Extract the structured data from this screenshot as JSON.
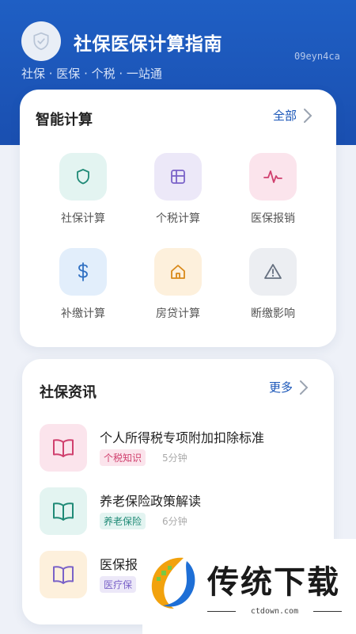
{
  "header": {
    "title": "社保医保计算指南",
    "subtitle": "社保 · 医保 · 个税 · 一站通",
    "tag": "09eyn4ca",
    "logo_icon": "shield-check-icon"
  },
  "calc": {
    "title": "智能计算",
    "all_label": "全部",
    "items": [
      {
        "label": "社保计算",
        "icon": "shield-icon",
        "bg": "#e3f4f1",
        "color": "#1f8a76"
      },
      {
        "label": "个税计算",
        "icon": "table-icon",
        "bg": "#ece8f8",
        "color": "#7a62c8"
      },
      {
        "label": "医保报销",
        "icon": "pulse-icon",
        "bg": "#fbe4ec",
        "color": "#d0406e"
      },
      {
        "label": "补缴计算",
        "icon": "dollar-icon",
        "bg": "#e2eefb",
        "color": "#2e6fc2"
      },
      {
        "label": "房贷计算",
        "icon": "home-icon",
        "bg": "#fdf0dc",
        "color": "#d9891a"
      },
      {
        "label": "断缴影响",
        "icon": "warning-icon",
        "bg": "#eceef2",
        "color": "#667080"
      }
    ]
  },
  "news": {
    "title": "社保资讯",
    "more_label": "更多",
    "items": [
      {
        "title": "个人所得税专项附加扣除标准",
        "tag": "个税知识",
        "time": "5分钟",
        "thumb_bg": "#fbe4ec",
        "icon_color": "#d0406e",
        "tag_bg": "#fbe4ec",
        "tag_color": "#d0406e"
      },
      {
        "title": "养老保险政策解读",
        "tag": "养老保险",
        "time": "6分钟",
        "thumb_bg": "#e3f4f1",
        "icon_color": "#1f8a76",
        "tag_bg": "#e3f4f1",
        "tag_color": "#1f8a76"
      },
      {
        "title": "医保报",
        "tag": "医疗保",
        "time": "",
        "thumb_bg": "#fdf0dc",
        "icon_color": "#7a62c8",
        "tag_bg": "#ece8f8",
        "tag_color": "#7a62c8"
      }
    ]
  },
  "brand": {
    "name": "传统下载",
    "domain": "ctdown.com"
  }
}
